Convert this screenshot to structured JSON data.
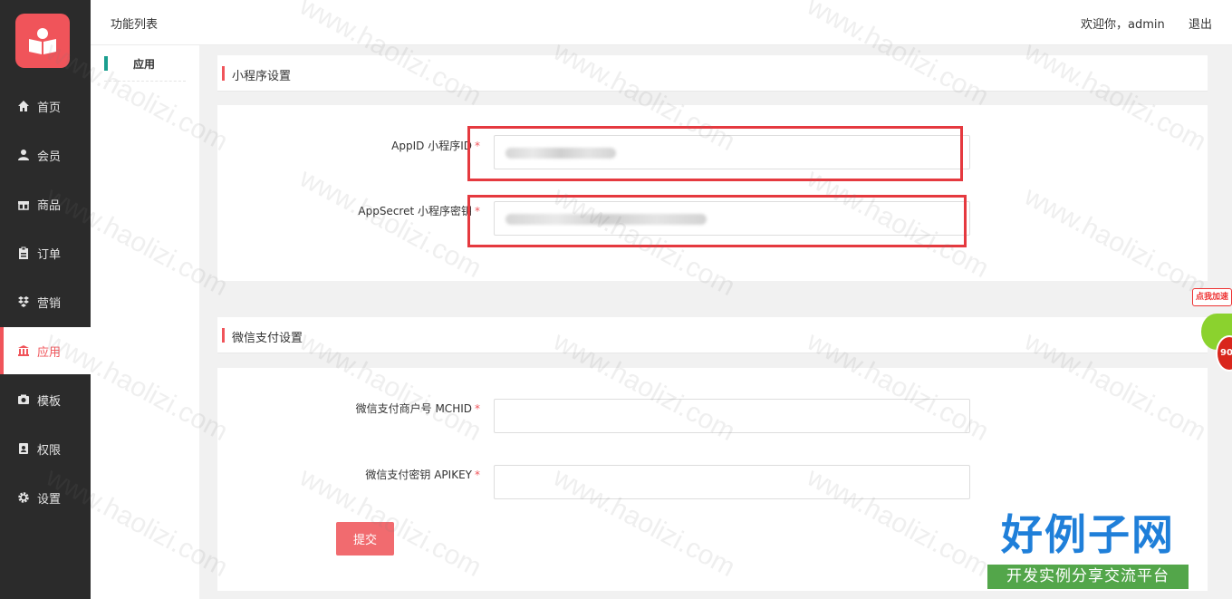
{
  "sidebar": {
    "items": [
      {
        "label": "首页",
        "icon": "home-icon"
      },
      {
        "label": "会员",
        "icon": "user-icon"
      },
      {
        "label": "商品",
        "icon": "gift-icon"
      },
      {
        "label": "订单",
        "icon": "clipboard-icon"
      },
      {
        "label": "营销",
        "icon": "dropbox-icon"
      },
      {
        "label": "应用",
        "icon": "bank-icon",
        "active": true
      },
      {
        "label": "模板",
        "icon": "camera-icon"
      },
      {
        "label": "权限",
        "icon": "badge-icon"
      },
      {
        "label": "设置",
        "icon": "gear-icon"
      }
    ]
  },
  "header": {
    "title": "功能列表",
    "welcome": "欢迎你，admin",
    "logout": "退出"
  },
  "subnav": {
    "items": [
      {
        "label": "应用",
        "active": true
      }
    ]
  },
  "sections": {
    "miniprogram": {
      "title": "小程序设置",
      "fields": [
        {
          "label": "AppID 小程序ID",
          "required": "*"
        },
        {
          "label": "AppSecret 小程序密钥",
          "required": "*"
        }
      ]
    },
    "wxpay": {
      "title": "微信支付设置",
      "fields": [
        {
          "label": "微信支付商户号 MCHID",
          "required": "*"
        },
        {
          "label": "微信支付密钥 APIKEY",
          "required": "*"
        }
      ]
    }
  },
  "form": {
    "submit_label": "提交"
  },
  "watermark": "www.haolizi.com",
  "brand": {
    "big": "好例子网",
    "small": "开发实例分享交流平台"
  },
  "speed_widget": {
    "tag": "点我加速",
    "value": "90"
  },
  "colors": {
    "accent": "#f0545a",
    "sidebar_bg": "#2b2b2b",
    "subnav_bar": "#1a9e8f",
    "highlight": "#e5393f",
    "brand_blue": "#1f7fd9",
    "brand_green": "#53a64a"
  }
}
